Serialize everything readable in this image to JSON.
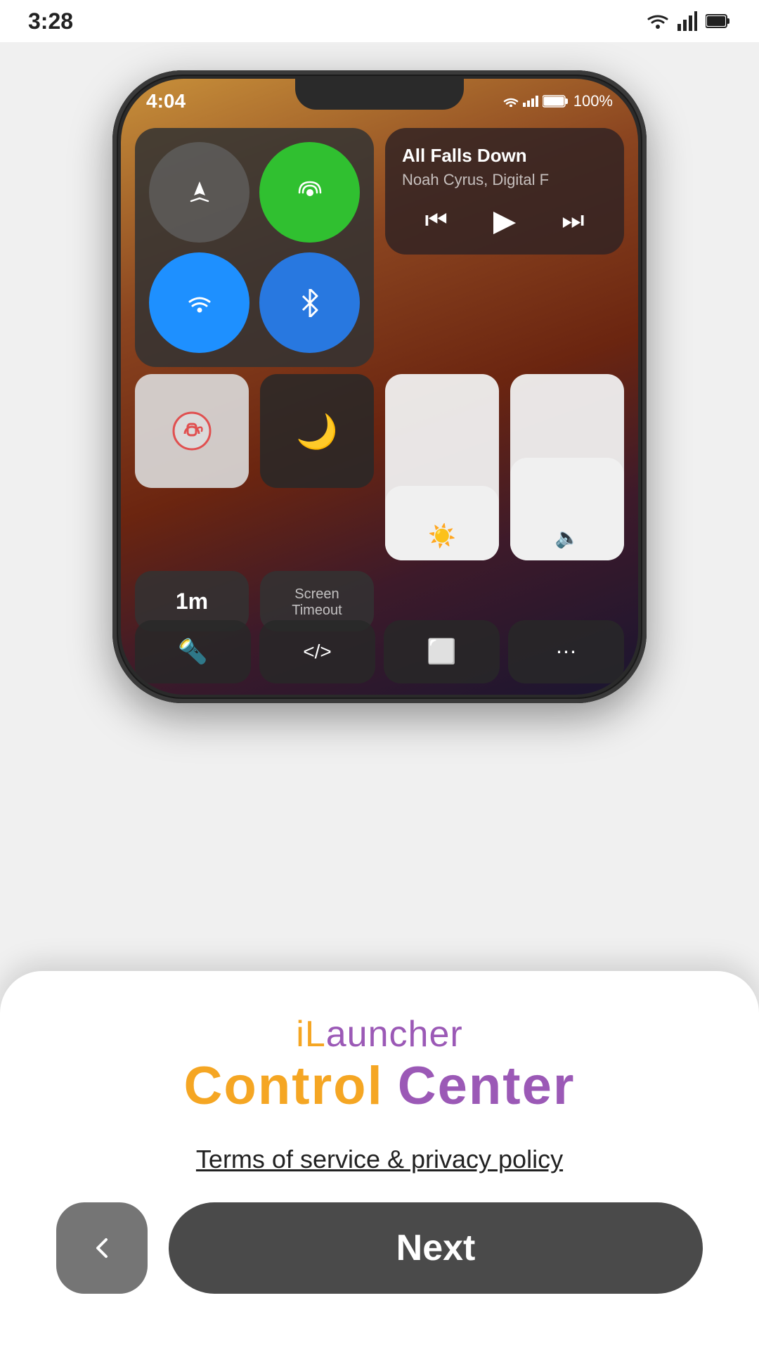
{
  "status_bar": {
    "time": "3:28",
    "icons": [
      "wifi",
      "signal",
      "battery"
    ]
  },
  "phone": {
    "status": {
      "time": "4:04",
      "battery": "100%"
    },
    "music": {
      "title": "All Falls Down",
      "artist": "Noah Cyrus, Digital F"
    },
    "screen_timeout": {
      "value": "1m",
      "label": "Screen\nTimeout"
    }
  },
  "card": {
    "app_name": "iLauncher",
    "app_name_prefix": "iL",
    "app_name_suffix": "auncher",
    "subtitle_part1": "Control",
    "subtitle_part2": "Center",
    "terms_text": "Terms of service & privacy policy",
    "back_label": "←",
    "next_label": "Next"
  }
}
